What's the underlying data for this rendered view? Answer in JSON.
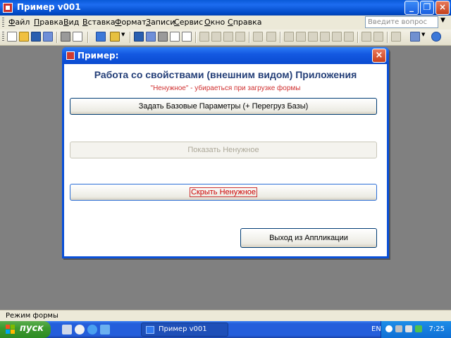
{
  "window": {
    "title": "Пример v001"
  },
  "menu": {
    "items": [
      "Файл",
      "Правка",
      "Вид",
      "Вставка",
      "Формат",
      "Записи",
      "Сервис",
      "Окно",
      "Справка"
    ],
    "help_placeholder": "Введите вопрос"
  },
  "dialog": {
    "title": "Пример:",
    "heading": "Работа со свойствами (внешним видом) Приложения",
    "subheading": "\"Ненужное\" - убираеться при загрузке формы",
    "btn_set_params": "Задать Базовые Параметры (+ Перегруз Базы)",
    "btn_show": "Показать Ненужное",
    "btn_hide": "Скрыть Ненужное",
    "btn_exit": "Выход из Аппликации"
  },
  "status": {
    "text": "Режим формы"
  },
  "taskbar": {
    "start_label": "пуск",
    "task_label": "Пример v001",
    "lang": "EN",
    "time": "7:25"
  },
  "colors": {
    "title_blue": "#0a50d8",
    "heading_blue": "#243f78",
    "subheading_red": "#d03030",
    "start_green": "#3c9a2f"
  }
}
